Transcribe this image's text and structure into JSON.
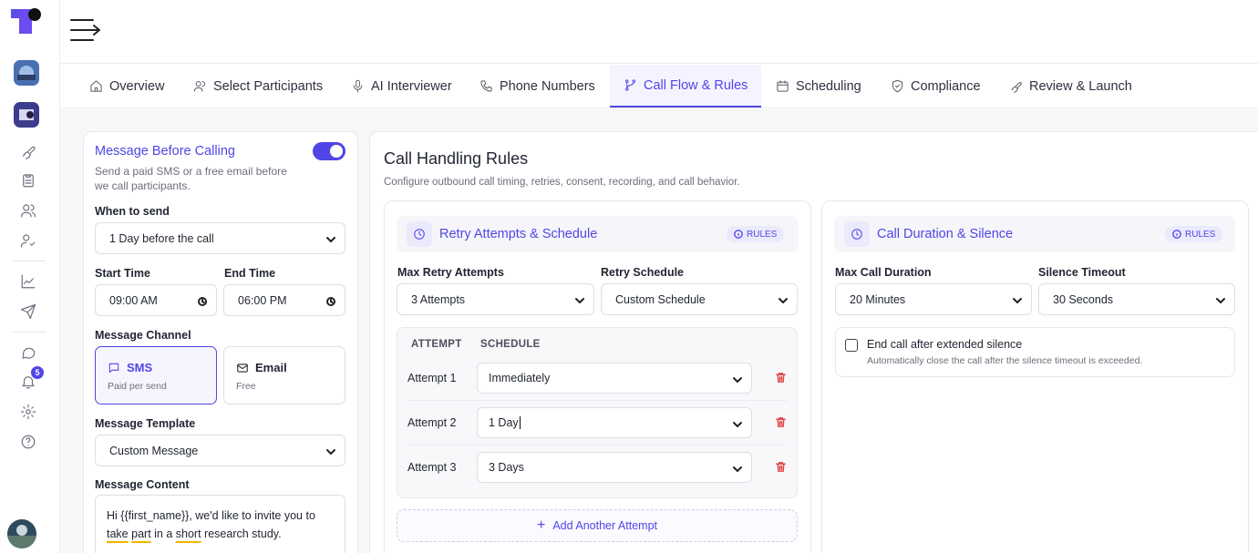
{
  "tabs": [
    {
      "label": "Overview",
      "icon": "home-icon"
    },
    {
      "label": "Select Participants",
      "icon": "users-icon"
    },
    {
      "label": "AI Interviewer",
      "icon": "mic-icon"
    },
    {
      "label": "Phone Numbers",
      "icon": "phone-icon"
    },
    {
      "label": "Call Flow & Rules",
      "icon": "flow-icon",
      "active": true
    },
    {
      "label": "Scheduling",
      "icon": "calendar-icon"
    },
    {
      "label": "Compliance",
      "icon": "shield-icon"
    },
    {
      "label": "Review & Launch",
      "icon": "rocket-icon"
    }
  ],
  "sidebar": {
    "notification_count": "5",
    "accent": "#4f46e5"
  },
  "message_panel": {
    "title": "Message Before Calling",
    "description": "Send a paid SMS or a free email before we call participants.",
    "enabled": true,
    "when_to_send_label": "When to send",
    "when_to_send_value": "1 Day before the call",
    "start_time_label": "Start Time",
    "start_time_value": "09:00 AM",
    "end_time_label": "End Time",
    "end_time_value": "06:00 PM",
    "channel_label": "Message Channel",
    "channels": [
      {
        "name": "SMS",
        "sub": "Paid per send",
        "selected": true
      },
      {
        "name": "Email",
        "sub": "Free",
        "selected": false
      }
    ],
    "template_label": "Message Template",
    "template_value": "Custom Message",
    "content_label": "Message Content",
    "content_part1": "Hi {{first_name}}, we'd like to invite you to ",
    "content_part2": "take",
    "content_part3": "part",
    "content_part4": " in a ",
    "content_part5": "short",
    "content_part6": " research study."
  },
  "call_rules": {
    "title": "Call Handling Rules",
    "subtitle": "Configure outbound call timing, retries, consent, recording, and call behavior.",
    "retry": {
      "title": "Retry Attempts & Schedule",
      "badge": "RULES",
      "max_label": "Max Retry Attempts",
      "max_value": "3 Attempts",
      "schedule_label": "Retry Schedule",
      "schedule_value": "Custom Schedule",
      "col_attempt": "ATTEMPT",
      "col_schedule": "SCHEDULE",
      "attempts": [
        {
          "label": "Attempt 1",
          "value": "Immediately"
        },
        {
          "label": "Attempt 2",
          "value": "1 Day"
        },
        {
          "label": "Attempt 3",
          "value": "3 Days"
        }
      ],
      "add_label": "Add Another Attempt"
    },
    "duration": {
      "title": "Call Duration & Silence",
      "badge": "RULES",
      "max_label": "Max Call Duration",
      "max_value": "20 Minutes",
      "silence_label": "Silence Timeout",
      "silence_value": "30 Seconds",
      "check_label": "End call after extended silence",
      "check_sub": "Automatically close the call after the silence timeout is exceeded.",
      "checked": false
    }
  }
}
